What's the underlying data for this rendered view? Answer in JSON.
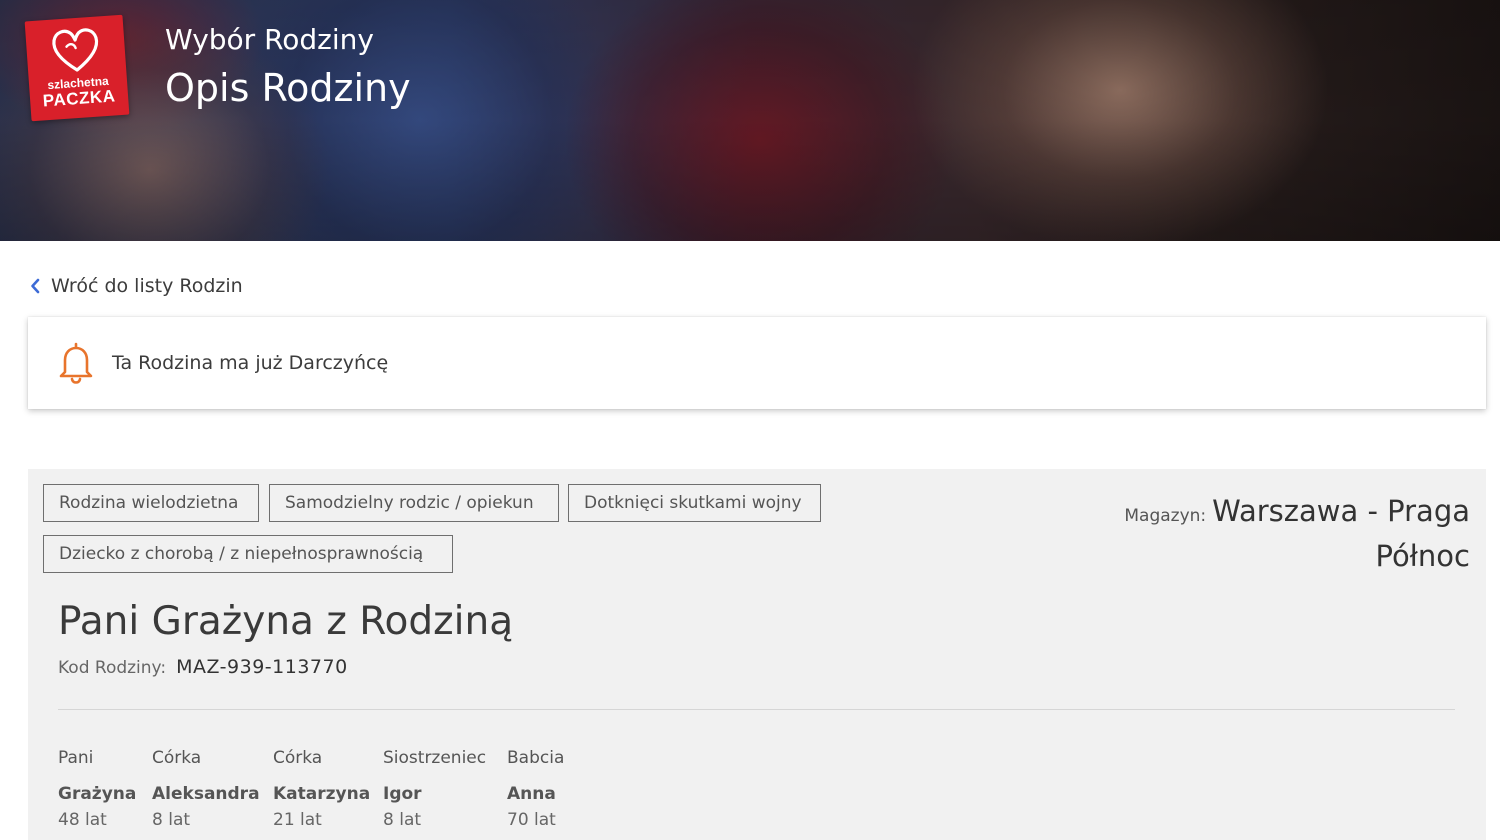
{
  "header": {
    "logo": {
      "line1": "szlachetna",
      "line2": "PACZKA"
    },
    "subtitle": "Wybór Rodziny",
    "title": "Opis Rodziny"
  },
  "back_link": {
    "label": "Wróć do listy Rodzin",
    "icon": "chevron-left-icon"
  },
  "notice": {
    "icon": "bell-icon",
    "text": "Ta Rodzina ma już Darczyńcę",
    "icon_color": "#e8742c"
  },
  "family": {
    "tags": [
      "Rodzina wielodzietna",
      "Samodzielny rodzic / opiekun",
      "Dotknięci skutkami wojny",
      "Dziecko z chorobą / z niepełnosprawnością"
    ],
    "warehouse_label": "Magazyn:",
    "warehouse_line1": "Warszawa - Praga",
    "warehouse_line2": "Północ",
    "name": "Pani Grażyna z Rodziną",
    "code_label": "Kod Rodziny:",
    "code": "MAZ-939-113770",
    "members": [
      {
        "role": "Pani",
        "name": "Grażyna",
        "age": "48 lat"
      },
      {
        "role": "Córka",
        "name": "Aleksandra",
        "age": "8 lat"
      },
      {
        "role": "Córka",
        "name": "Katarzyna",
        "age": "21 lat"
      },
      {
        "role": "Siostrzeniec",
        "name": "Igor",
        "age": "8 lat"
      },
      {
        "role": "Babcia",
        "name": "Anna",
        "age": "70 lat"
      }
    ]
  },
  "colors": {
    "brand_red": "#d9202a",
    "link_chevron": "#3d6bd6",
    "card_background": "#f1f1f1"
  }
}
